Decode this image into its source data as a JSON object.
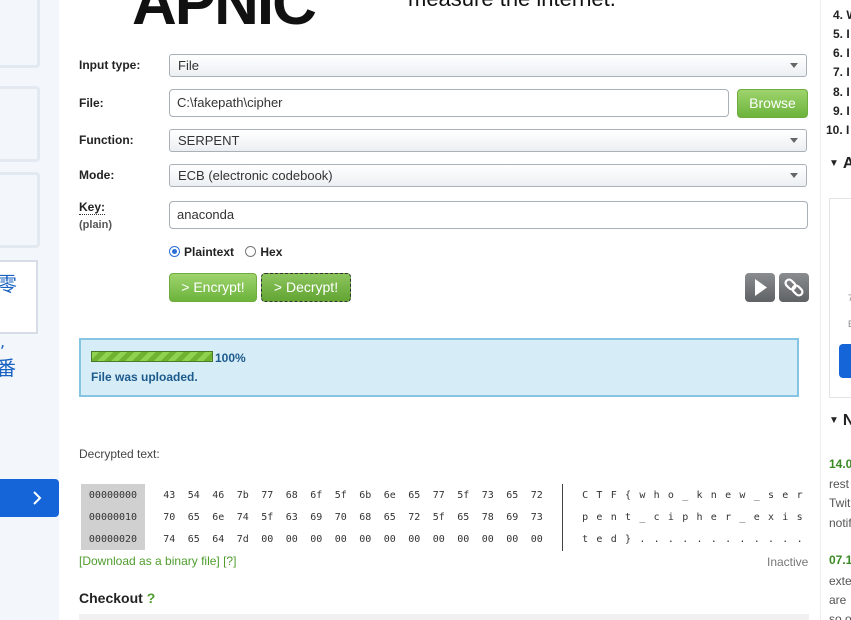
{
  "header": {
    "logo_text": "APNIC",
    "tagline": "measure the internet."
  },
  "left_rail": {
    "ghost_chars": [
      "",
      "",
      ""
    ],
    "blue_text": "零",
    "blue_comma": ",",
    "blue_text2": "番"
  },
  "form": {
    "input_type": {
      "label": "Input type:",
      "value": "File"
    },
    "file": {
      "label": "File:",
      "value": "C:\\fakepath\\cipher",
      "browse_label": "Browse"
    },
    "function": {
      "label": "Function:",
      "value": "SERPENT"
    },
    "mode": {
      "label": "Mode:",
      "value": "ECB (electronic codebook)"
    },
    "key": {
      "label": "Key:",
      "sublabel": "(plain)",
      "value": "anaconda"
    },
    "key_format": {
      "options": [
        "Plaintext",
        "Hex"
      ],
      "selected": "Plaintext"
    },
    "encrypt_label": "> Encrypt!",
    "decrypt_label": "> Decrypt!",
    "icons": [
      "play-icon",
      "link-icon"
    ]
  },
  "upload": {
    "progress": 1.0,
    "progress_text": "100%",
    "message": "File was uploaded."
  },
  "decrypted": {
    "title": "Decrypted text:",
    "rows": [
      {
        "offset": "00000000",
        "hex": [
          "43",
          "54",
          "46",
          "7b",
          "77",
          "68",
          "6f",
          "5f",
          "6b",
          "6e",
          "65",
          "77",
          "5f",
          "73",
          "65",
          "72"
        ],
        "ascii": [
          "C",
          "T",
          "F",
          "{",
          "w",
          "h",
          "o",
          "_",
          "k",
          "n",
          "e",
          "w",
          "_",
          "s",
          "e",
          "r"
        ]
      },
      {
        "offset": "00000010",
        "hex": [
          "70",
          "65",
          "6e",
          "74",
          "5f",
          "63",
          "69",
          "70",
          "68",
          "65",
          "72",
          "5f",
          "65",
          "78",
          "69",
          "73"
        ],
        "ascii": [
          "p",
          "e",
          "n",
          "t",
          "_",
          "c",
          "i",
          "p",
          "h",
          "e",
          "r",
          "_",
          "e",
          "x",
          "i",
          "s"
        ]
      },
      {
        "offset": "00000020",
        "hex": [
          "74",
          "65",
          "64",
          "7d",
          "00",
          "00",
          "00",
          "00",
          "00",
          "00",
          "00",
          "00",
          "00",
          "00",
          "00",
          "00"
        ],
        "ascii": [
          "t",
          "e",
          "d",
          "}",
          ".",
          ".",
          ".",
          ".",
          ".",
          ".",
          ".",
          ".",
          ".",
          ".",
          ".",
          "."
        ]
      }
    ],
    "download_link": "[Download as a binary file]",
    "help_link": "[?]",
    "status": "Inactive"
  },
  "checkout": {
    "title": "Checkout",
    "help": "?"
  },
  "right_rail": {
    "numbers": [
      "4. W",
      "5. I",
      "6. I",
      "7. I",
      "8. I",
      "9. I",
      "10. I"
    ],
    "heading_a": "A",
    "heading_n": "N",
    "widget_letters": [
      "7",
      "E"
    ],
    "news": [
      {
        "date": "14.0",
        "lines": [
          "rest",
          "Twit",
          "notif"
        ]
      },
      {
        "date": "07.1",
        "lines": [
          "exte",
          "are",
          "so o"
        ]
      }
    ]
  },
  "colors": {
    "accent_green": "#6cb33c",
    "link_green": "#4f9d2d",
    "info_blue_bg": "#d6edf8",
    "brand_blue": "#1565d8"
  }
}
